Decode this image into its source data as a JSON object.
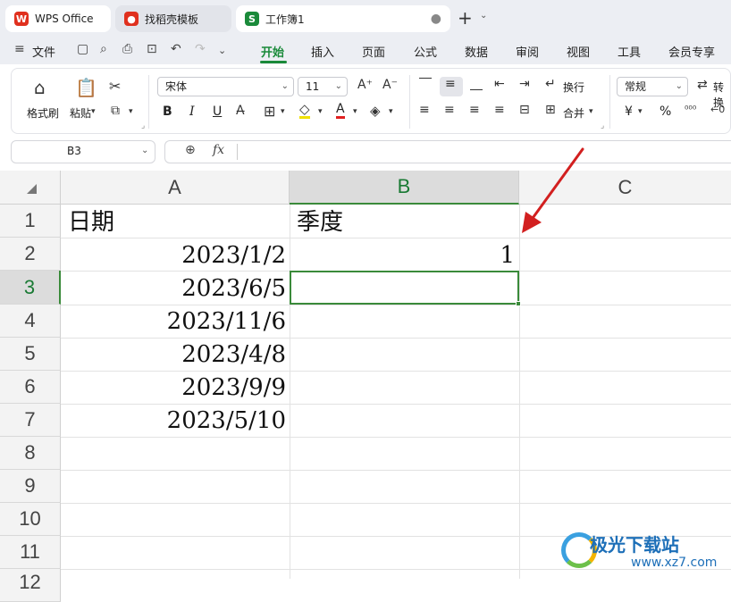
{
  "tabs": {
    "wps": "WPS Office",
    "templates": "找稻壳模板",
    "workbook": "工作簿1"
  },
  "menu": {
    "file": "文件",
    "items": [
      "开始",
      "插入",
      "页面",
      "公式",
      "数据",
      "审阅",
      "视图",
      "工具",
      "会员专享"
    ]
  },
  "ribbon": {
    "format_painter": "格式刷",
    "paste": "粘贴",
    "font_name": "宋体",
    "font_size": "11",
    "wrap": "换行",
    "merge": "合并",
    "number_format": "常规",
    "convert": "转换",
    "bold": "B",
    "italic": "I",
    "underline": "U",
    "currency": "¥",
    "percent": "%"
  },
  "formula_bar": {
    "name_box": "B3",
    "fx": "fx",
    "value": ""
  },
  "columns": [
    "A",
    "B",
    "C"
  ],
  "rows": [
    "1",
    "2",
    "3",
    "4",
    "5",
    "6",
    "7",
    "8",
    "9",
    "10",
    "11",
    "12"
  ],
  "cells": {
    "A1": "日期",
    "B1": "季度",
    "A2": "2023/1/2",
    "B2": "1",
    "A3": "2023/6/5",
    "A4": "2023/11/6",
    "A5": "2023/4/8",
    "A6": "2023/9/9",
    "A7": "2023/5/10"
  },
  "watermark": {
    "title": "极光下载站",
    "url": "www.xz7.com"
  },
  "colors": {
    "accent": "#1a8a3a",
    "arrow": "#d21f1f"
  }
}
